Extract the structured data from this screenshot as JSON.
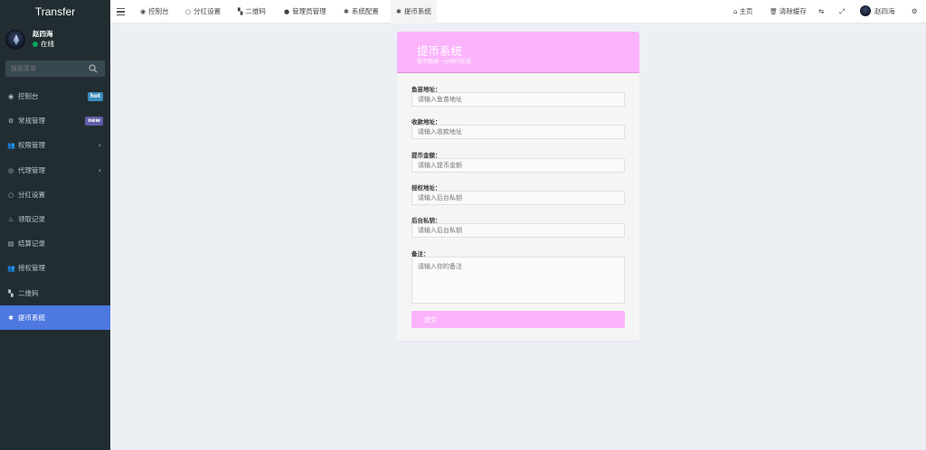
{
  "app": {
    "brand": "Transfer"
  },
  "user": {
    "name": "赵四海",
    "status": "在线"
  },
  "sidebar": {
    "search_placeholder": "搜索菜单",
    "items": [
      {
        "label": "控制台",
        "icon": "dashboard-icon",
        "glyph": "◉",
        "badge": "hot"
      },
      {
        "label": "常规管理",
        "icon": "cogs-icon",
        "glyph": "⚙",
        "badge": "new"
      },
      {
        "label": "权限管理",
        "icon": "users-icon",
        "glyph": "👥",
        "arrow": "‹"
      },
      {
        "label": "代理管理",
        "icon": "user-circle-icon",
        "glyph": "◎",
        "arrow": "‹"
      },
      {
        "label": "分红设置",
        "icon": "circle-icon",
        "glyph": "○"
      },
      {
        "label": "领取记录",
        "icon": "cake-icon",
        "glyph": "♨"
      },
      {
        "label": "结算记录",
        "icon": "list-icon",
        "glyph": "▤"
      },
      {
        "label": "授权管理",
        "icon": "users-icon",
        "glyph": "👥"
      },
      {
        "label": "二维码",
        "icon": "qrcode-icon",
        "glyph": "▚"
      },
      {
        "label": "提币系统",
        "icon": "gear-icon",
        "glyph": "✱",
        "active": true
      }
    ]
  },
  "topnav": {
    "tabs": [
      {
        "label": "控制台",
        "glyph": "◉"
      },
      {
        "label": "分红设置",
        "glyph": "○"
      },
      {
        "label": "二维码",
        "glyph": "▚"
      },
      {
        "label": "管理员管理",
        "glyph": "●"
      },
      {
        "label": "系统配置",
        "glyph": "✱"
      },
      {
        "label": "提币系统",
        "glyph": "✱",
        "active": true
      }
    ],
    "home_label": "主页",
    "clear_cache_label": "清除缓存",
    "user_name": "赵四海"
  },
  "form": {
    "title": "提币系统",
    "subtitle": "提币额度一分钟内完成",
    "fields": [
      {
        "label": "鱼苗地址：",
        "placeholder": "请输入鱼苗地址"
      },
      {
        "label": "收款地址：",
        "placeholder": "请输入收款地址"
      },
      {
        "label": "提币金额：",
        "placeholder": "请输入提币金额"
      },
      {
        "label": "授权地址：",
        "placeholder": "请输入后台私钥"
      },
      {
        "label": "后台私钥：",
        "placeholder": "请输入后台私钥"
      }
    ],
    "remark": {
      "label": "备注：",
      "placeholder": "请输入你的备注"
    },
    "submit_label": "提交"
  },
  "colors": {
    "sidebar_bg": "#222d32",
    "active_menu": "#4c78e0",
    "accent_pink": "#fbb3fc",
    "hot_badge": "#3c8dbc",
    "new_badge": "#605ca8",
    "online_dot": "#00a65a"
  }
}
